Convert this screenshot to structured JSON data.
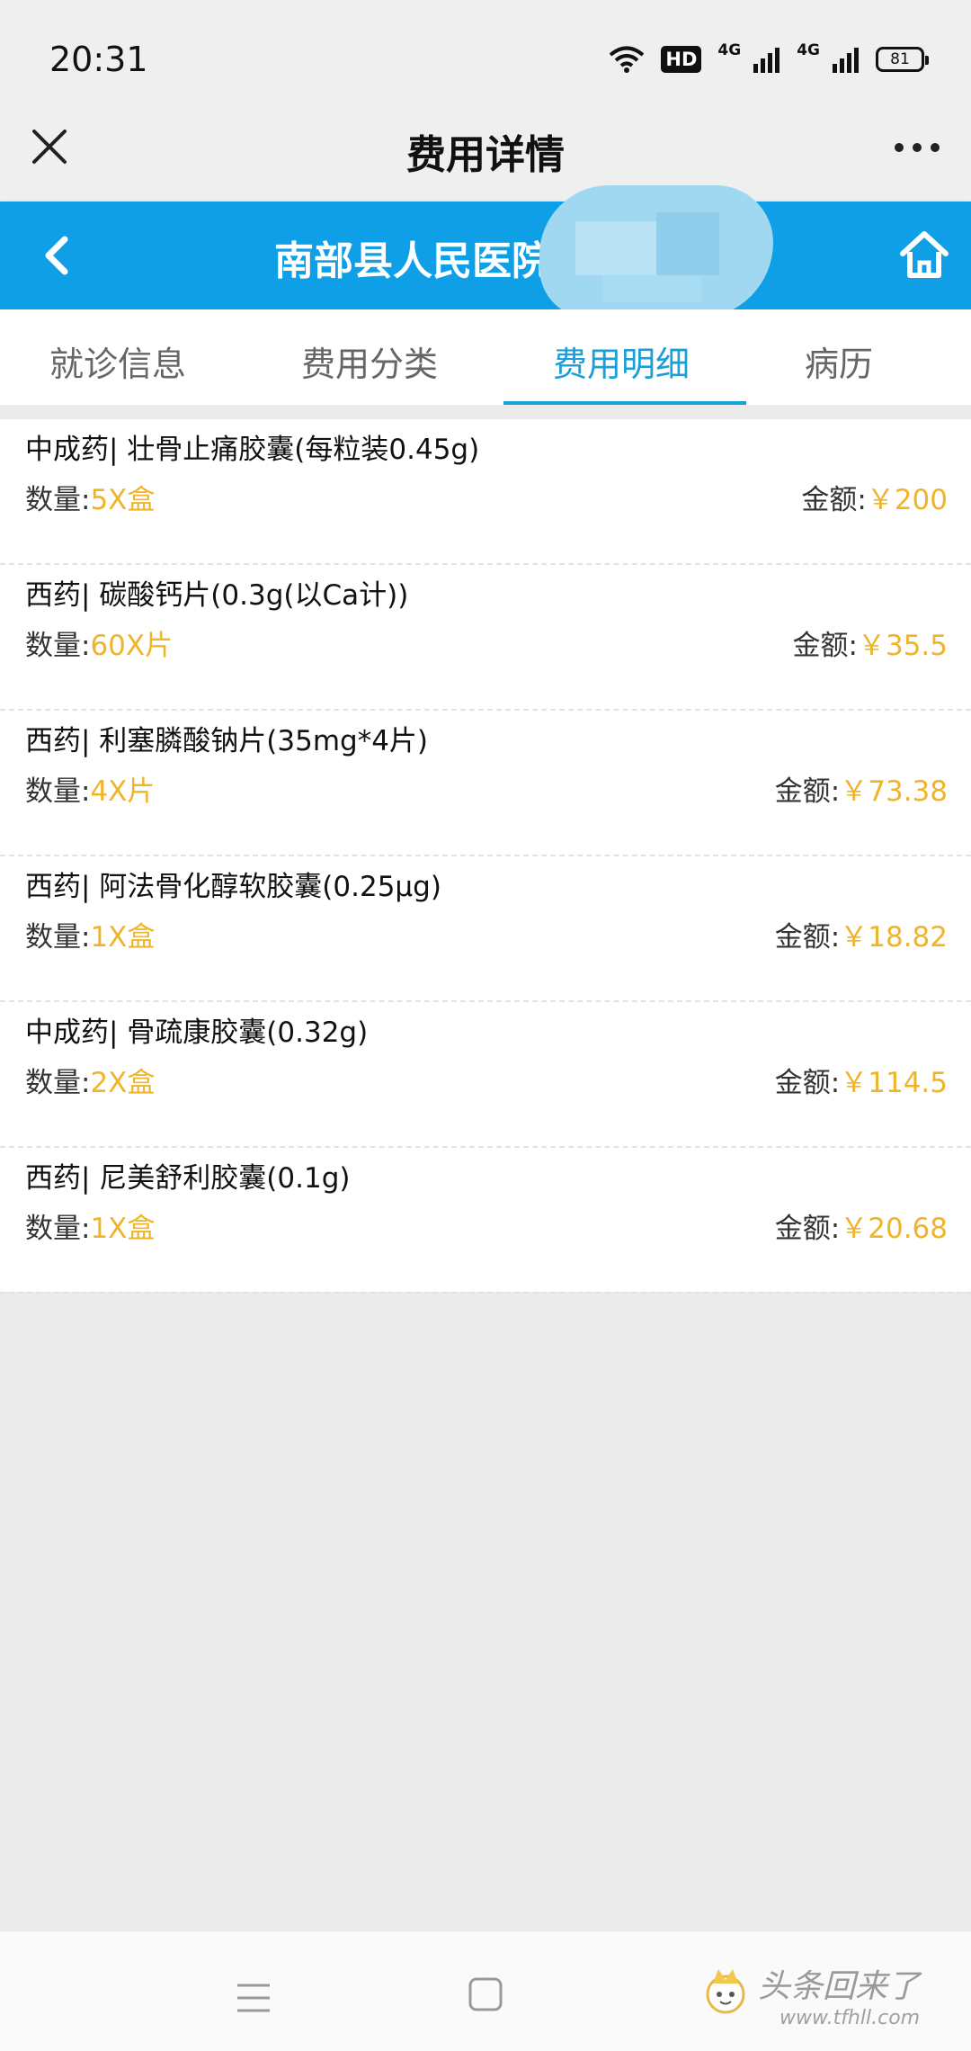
{
  "status_bar": {
    "time": "20:31",
    "hd_label": "HD",
    "net1": "4G",
    "net2": "4G",
    "battery": "81"
  },
  "title_bar": {
    "title": "费用详情",
    "close_icon": "close-icon",
    "more_icon": "more-icon"
  },
  "hospital_header": {
    "name": "南部县人民医院",
    "back_icon": "chevron-left-icon",
    "home_icon": "home-icon",
    "background": "#0e9fe6"
  },
  "tabs": [
    {
      "label": "就诊信息",
      "active": false
    },
    {
      "label": "费用分类",
      "active": false
    },
    {
      "label": "费用明细",
      "active": true
    },
    {
      "label": "病历",
      "active": false
    }
  ],
  "colors": {
    "accent": "#1a9fd8",
    "value": "#f0b429"
  },
  "items": [
    {
      "name": "中成药| 壮骨止痛胶囊(每粒装0.45g)",
      "qty_label": "数量:",
      "qty": "5X盒",
      "amount_label": "金额:",
      "amount": "￥200"
    },
    {
      "name": "西药| 碳酸钙片(0.3g(以Ca计))",
      "qty_label": "数量:",
      "qty": "60X片",
      "amount_label": "金额:",
      "amount": "￥35.5"
    },
    {
      "name": "西药| 利塞膦酸钠片(35mg*4片)",
      "qty_label": "数量:",
      "qty": "4X片",
      "amount_label": "金额:",
      "amount": "￥73.38"
    },
    {
      "name": "西药| 阿法骨化醇软胶囊(0.25μg)",
      "qty_label": "数量:",
      "qty": "1X盒",
      "amount_label": "金额:",
      "amount": "￥18.82"
    },
    {
      "name": "中成药| 骨疏康胶囊(0.32g)",
      "qty_label": "数量:",
      "qty": "2X盒",
      "amount_label": "金额:",
      "amount": "￥114.5"
    },
    {
      "name": "西药| 尼美舒利胶囊(0.1g)",
      "qty_label": "数量:",
      "qty": "1X盒",
      "amount_label": "金额:",
      "amount": "￥20.68"
    }
  ],
  "nav_bar": {
    "menu_icon": "menu-icon",
    "home_icon": "square-home-icon"
  },
  "watermark": {
    "text": "头条回来了",
    "url": "www.tfhll.com"
  }
}
